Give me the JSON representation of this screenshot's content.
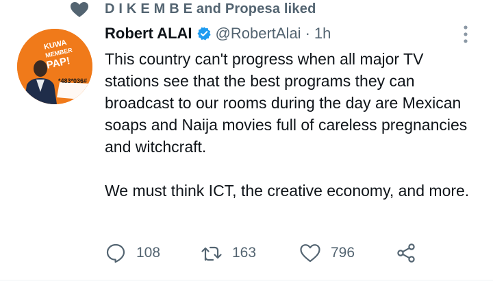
{
  "social_context": {
    "text": "D I K E M B E and Propesa liked",
    "icon": "heart-icon"
  },
  "tweet": {
    "author_name": "Robert ALAI",
    "verified": true,
    "handle": "@RobertAlai",
    "separator": "·",
    "time": "1h",
    "paragraphs": [
      "This country can't progress when all major TV stations see that the best programs they can broadcast to our rooms during the day are Mexican soaps and Naija movies full of careless pregnancies and witchcraft.",
      "We must think ICT, the creative economy, and more."
    ],
    "avatar_text": {
      "line1": "KUWA",
      "line2": "MEMBER",
      "line3": "PAP!",
      "code": "*483*036#"
    }
  },
  "actions": {
    "reply_count": "108",
    "retweet_count": "163",
    "like_count": "796"
  },
  "colors": {
    "text": "#0f1419",
    "secondary": "#536471",
    "verified": "#1d9bf0",
    "avatar_bg": "#f07a1a"
  }
}
